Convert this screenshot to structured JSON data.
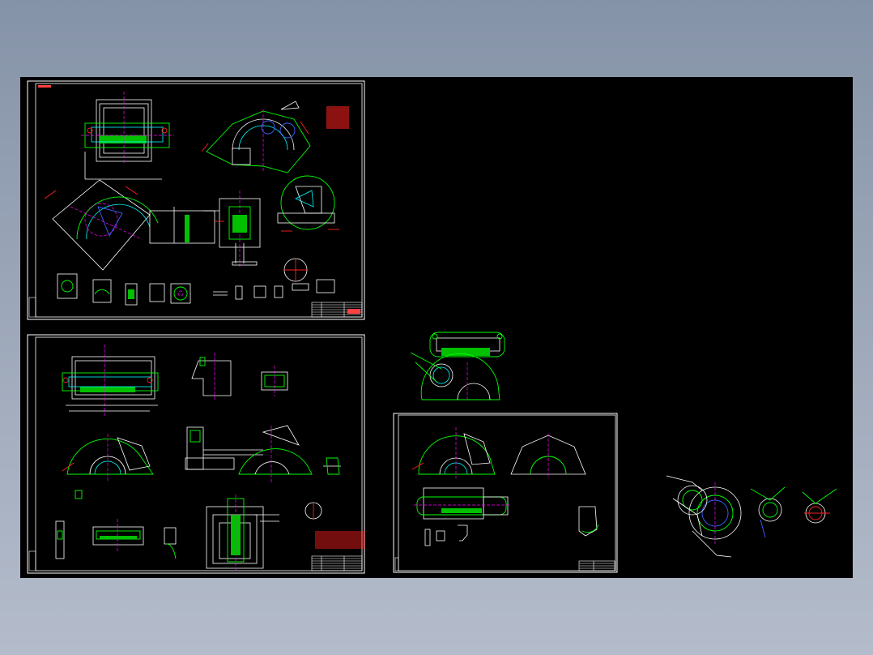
{
  "window": {
    "background_colors": [
      "#8593a8",
      "#b4bccb"
    ],
    "canvas_color": "#000000"
  },
  "colors": {
    "outline": "#00ff00",
    "centerline": "#ff00ff",
    "dimension": "#ff2020",
    "hatch": "#00ffff",
    "border": "#ffffff",
    "accent": "#ffff00",
    "blue_line": "#4060ff"
  },
  "sheets": [
    {
      "id": "sheet-1",
      "label": "assembly-drawing-sheet",
      "title_block_rows": 6
    },
    {
      "id": "sheet-2",
      "label": "assembly-drawing-sheet",
      "title_block_rows": 6
    },
    {
      "id": "sheet-3",
      "label": "part-drawing-sheet",
      "title_block_rows": 4
    }
  ],
  "loose_views": [
    {
      "label": "housing-perspective-view"
    },
    {
      "label": "cover-plate-views"
    }
  ]
}
